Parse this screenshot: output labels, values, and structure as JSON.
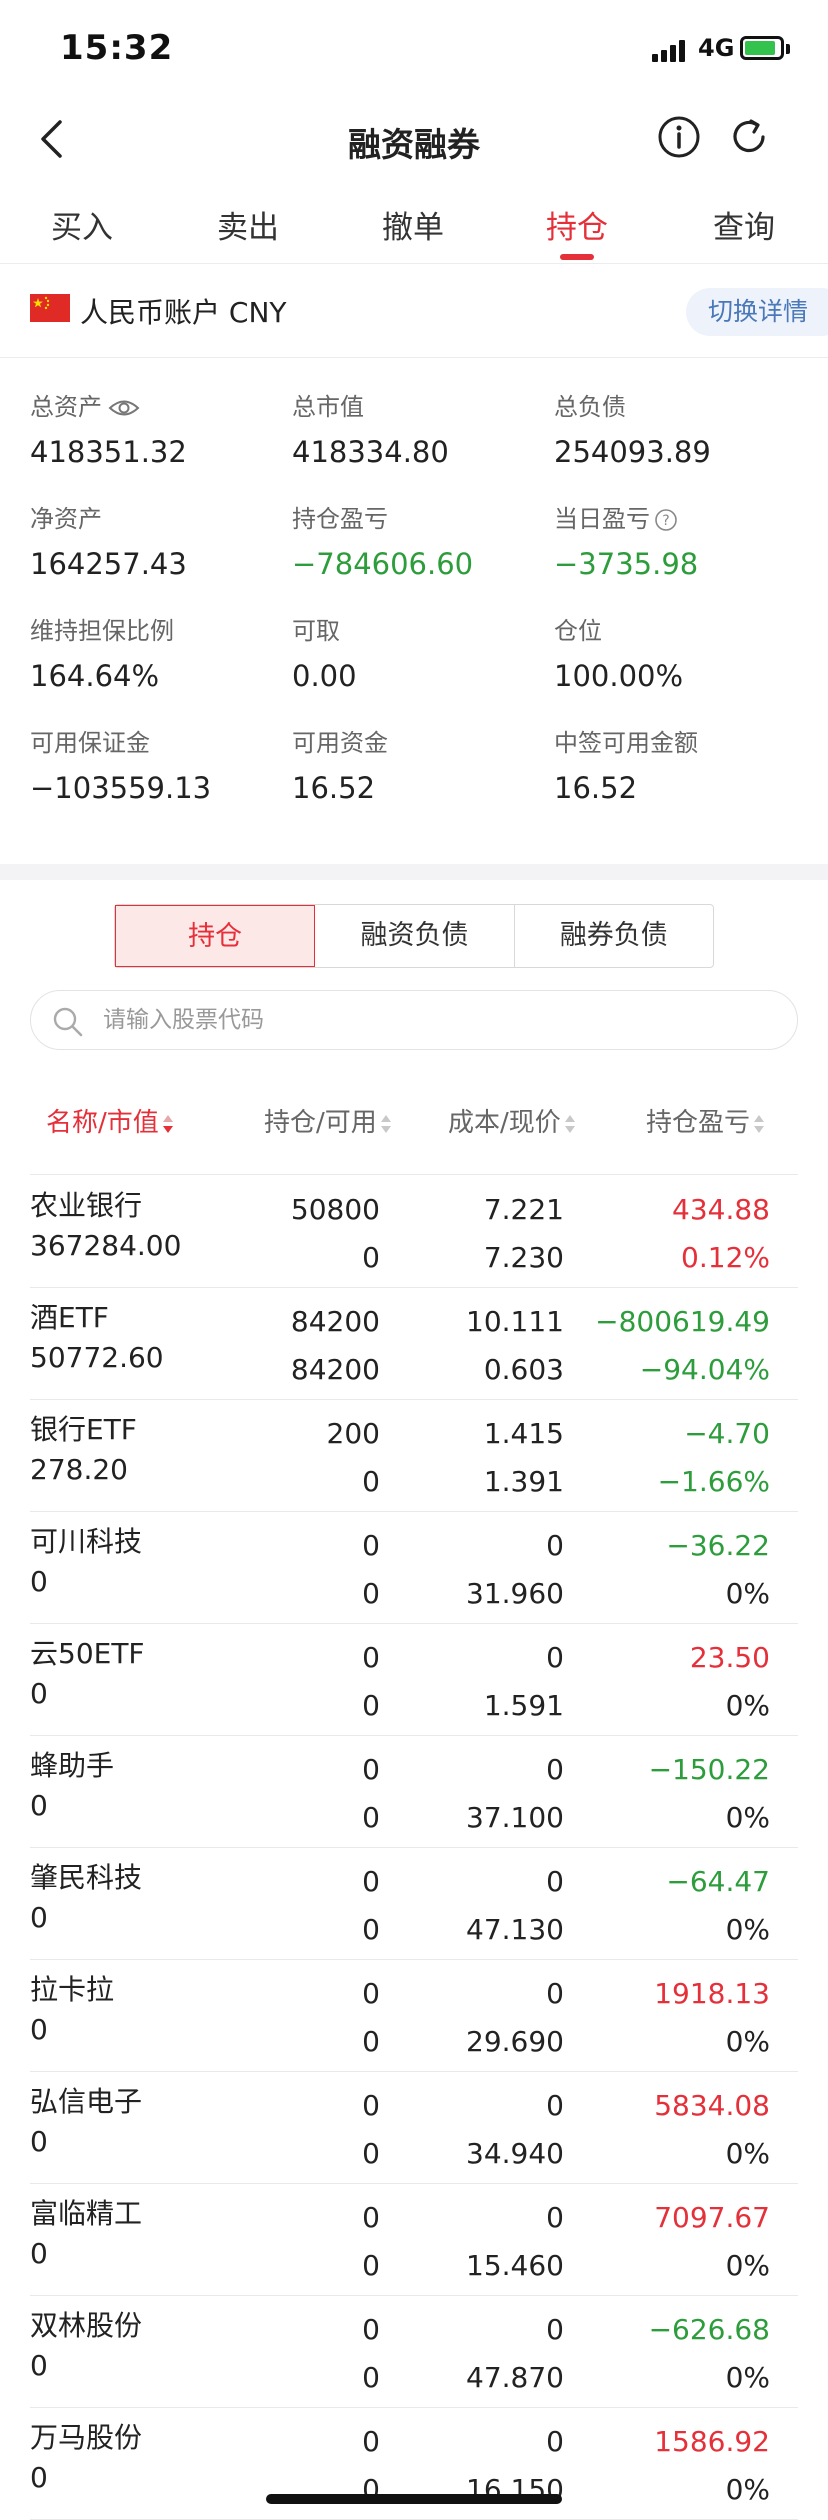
{
  "status": {
    "time": "15:32",
    "network": "4G"
  },
  "nav": {
    "title": "融资融券"
  },
  "tabs": [
    "买入",
    "卖出",
    "撤单",
    "持仓",
    "查询"
  ],
  "account": {
    "label": "人民币账户 CNY",
    "switch_label": "切换详情"
  },
  "summary": [
    {
      "label": "总资产",
      "value": "418351.32"
    },
    {
      "label": "总市值",
      "value": "418334.80"
    },
    {
      "label": "总负债",
      "value": "254093.89"
    },
    {
      "label": "净资产",
      "value": "164257.43"
    },
    {
      "label": "持仓盈亏",
      "value": "−784606.60"
    },
    {
      "label": "当日盈亏",
      "value": "−3735.98"
    },
    {
      "label": "维持担保比例",
      "value": "164.64%"
    },
    {
      "label": "可取",
      "value": "0.00"
    },
    {
      "label": "仓位",
      "value": "100.00%"
    },
    {
      "label": "可用保证金",
      "value": "−103559.13"
    },
    {
      "label": "可用资金",
      "value": "16.52"
    },
    {
      "label": "中签可用金额",
      "value": "16.52"
    }
  ],
  "segments": [
    "持仓",
    "融资负债",
    "融券负债"
  ],
  "search": {
    "placeholder": "请输入股票代码"
  },
  "table": {
    "headers": [
      "名称/市值",
      "持仓/可用",
      "成本/现价",
      "持仓盈亏"
    ],
    "rows": [
      {
        "name": "农业银行",
        "market_value": "367284.00",
        "position": "50800",
        "available": "0",
        "cost": "7.221",
        "price": "7.230",
        "pl": "434.88",
        "pl_pct": "0.12%",
        "pl_color": "red",
        "pct_color": "red"
      },
      {
        "name": "酒ETF",
        "market_value": "50772.60",
        "position": "84200",
        "available": "84200",
        "cost": "10.111",
        "price": "0.603",
        "pl": "−800619.49",
        "pl_pct": "−94.04%",
        "pl_color": "green",
        "pct_color": "green"
      },
      {
        "name": "银行ETF",
        "market_value": "278.20",
        "position": "200",
        "available": "0",
        "cost": "1.415",
        "price": "1.391",
        "pl": "−4.70",
        "pl_pct": "−1.66%",
        "pl_color": "green",
        "pct_color": "green"
      },
      {
        "name": "可川科技",
        "market_value": "0",
        "position": "0",
        "available": "0",
        "cost": "0",
        "price": "31.960",
        "pl": "−36.22",
        "pl_pct": "0%",
        "pl_color": "green",
        "pct_color": "black"
      },
      {
        "name": "云50ETF",
        "market_value": "0",
        "position": "0",
        "available": "0",
        "cost": "0",
        "price": "1.591",
        "pl": "23.50",
        "pl_pct": "0%",
        "pl_color": "red",
        "pct_color": "black"
      },
      {
        "name": "蜂助手",
        "market_value": "0",
        "position": "0",
        "available": "0",
        "cost": "0",
        "price": "37.100",
        "pl": "−150.22",
        "pl_pct": "0%",
        "pl_color": "green",
        "pct_color": "black"
      },
      {
        "name": "肇民科技",
        "market_value": "0",
        "position": "0",
        "available": "0",
        "cost": "0",
        "price": "47.130",
        "pl": "−64.47",
        "pl_pct": "0%",
        "pl_color": "green",
        "pct_color": "black"
      },
      {
        "name": "拉卡拉",
        "market_value": "0",
        "position": "0",
        "available": "0",
        "cost": "0",
        "price": "29.690",
        "pl": "1918.13",
        "pl_pct": "0%",
        "pl_color": "red",
        "pct_color": "black"
      },
      {
        "name": "弘信电子",
        "market_value": "0",
        "position": "0",
        "available": "0",
        "cost": "0",
        "price": "34.940",
        "pl": "5834.08",
        "pl_pct": "0%",
        "pl_color": "red",
        "pct_color": "black"
      },
      {
        "name": "富临精工",
        "market_value": "0",
        "position": "0",
        "available": "0",
        "cost": "0",
        "price": "15.460",
        "pl": "7097.67",
        "pl_pct": "0%",
        "pl_color": "red",
        "pct_color": "black"
      },
      {
        "name": "双林股份",
        "market_value": "0",
        "position": "0",
        "available": "0",
        "cost": "0",
        "price": "47.870",
        "pl": "−626.68",
        "pl_pct": "0%",
        "pl_color": "green",
        "pct_color": "black"
      },
      {
        "name": "万马股份",
        "market_value": "0",
        "position": "0",
        "available": "0",
        "cost": "0",
        "price": "16.150",
        "pl": "1586.92",
        "pl_pct": "0%",
        "pl_color": "red",
        "pct_color": "black"
      }
    ]
  },
  "colors": {
    "red": "#e5303a",
    "green": "#2d9d3c",
    "accent_blue": "#4a78b8"
  },
  "icons": [
    "back-icon",
    "info-icon",
    "refresh-icon",
    "eye-icon",
    "question-icon",
    "search-icon",
    "china-flag-icon",
    "sort-icon"
  ]
}
